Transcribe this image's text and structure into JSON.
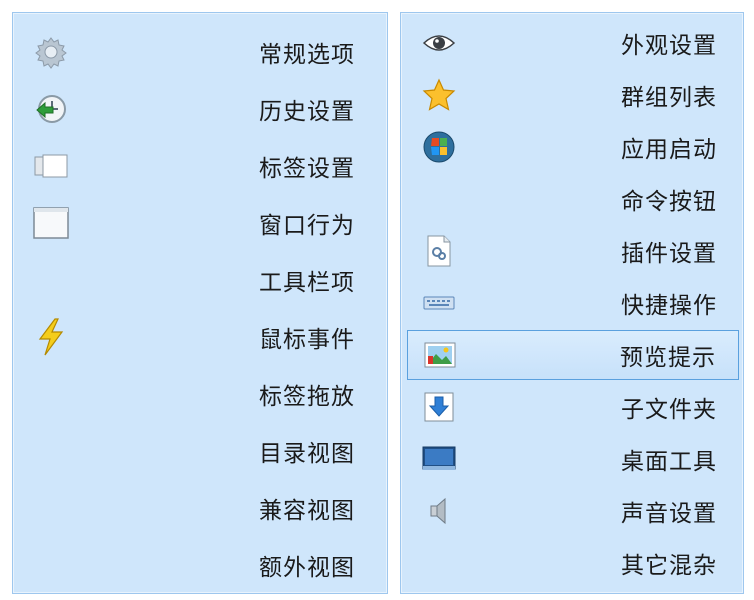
{
  "left_menu": {
    "items": [
      {
        "label": "常规选项",
        "icon": "gear-icon"
      },
      {
        "label": "历史设置",
        "icon": "history-icon"
      },
      {
        "label": "标签设置",
        "icon": "tab-icon"
      },
      {
        "label": "窗口行为",
        "icon": "window-icon"
      },
      {
        "label": "工具栏项",
        "icon": ""
      },
      {
        "label": "鼠标事件",
        "icon": "lightning-icon"
      },
      {
        "label": "标签拖放",
        "icon": ""
      },
      {
        "label": "目录视图",
        "icon": ""
      },
      {
        "label": "兼容视图",
        "icon": ""
      },
      {
        "label": "额外视图",
        "icon": ""
      }
    ]
  },
  "right_menu": {
    "selected_index": 6,
    "items": [
      {
        "label": "外观设置",
        "icon": "eye-icon"
      },
      {
        "label": "群组列表",
        "icon": "star-icon"
      },
      {
        "label": "应用启动",
        "icon": "app-launch-icon"
      },
      {
        "label": "命令按钮",
        "icon": ""
      },
      {
        "label": "插件设置",
        "icon": "plugin-icon"
      },
      {
        "label": "快捷操作",
        "icon": "keyboard-icon"
      },
      {
        "label": "预览提示",
        "icon": "preview-image-icon"
      },
      {
        "label": "子文件夹",
        "icon": "subfolder-download-icon"
      },
      {
        "label": "桌面工具",
        "icon": "desktop-icon"
      },
      {
        "label": "声音设置",
        "icon": "speaker-icon"
      },
      {
        "label": "其它混杂",
        "icon": ""
      }
    ]
  },
  "colors": {
    "panel_bg": "#cfe6fb",
    "selection_border": "#5aa0de"
  }
}
